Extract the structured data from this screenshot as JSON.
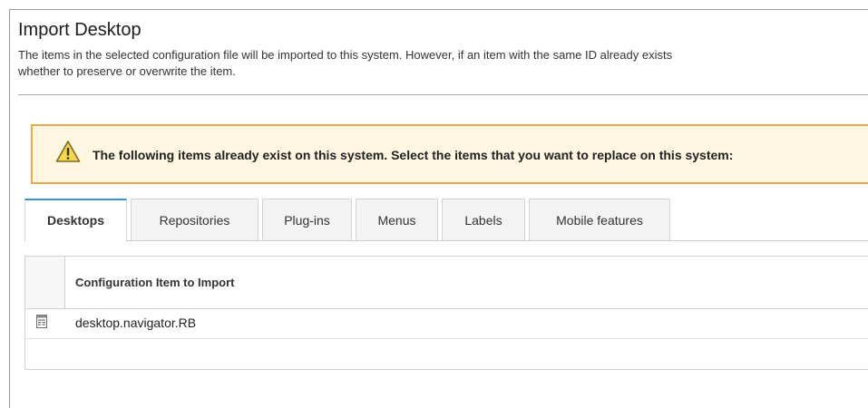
{
  "page": {
    "title": "Import Desktop",
    "description_line1": "The items in the selected configuration file will be imported to this system. However, if an item with the same ID already exists",
    "description_line2": "whether to preserve or overwrite the item."
  },
  "warning": {
    "icon": "warning-triangle-icon",
    "text": "The following items already exist on this system. Select the items that you want to replace on this system:"
  },
  "tabs": [
    {
      "label": "Desktops",
      "active": true
    },
    {
      "label": "Repositories",
      "active": false
    },
    {
      "label": "Plug-ins",
      "active": false
    },
    {
      "label": "Menus",
      "active": false
    },
    {
      "label": "Labels",
      "active": false
    },
    {
      "label": "Mobile features",
      "active": false
    }
  ],
  "table": {
    "column_header": "Configuration Item to Import",
    "rows": [
      {
        "icon": "document-icon",
        "name": "desktop.navigator.RB"
      }
    ]
  },
  "colors": {
    "warning_border": "#e8a84e",
    "warning_background": "#fdf6e1",
    "active_tab_accent": "#3b8fd6"
  }
}
